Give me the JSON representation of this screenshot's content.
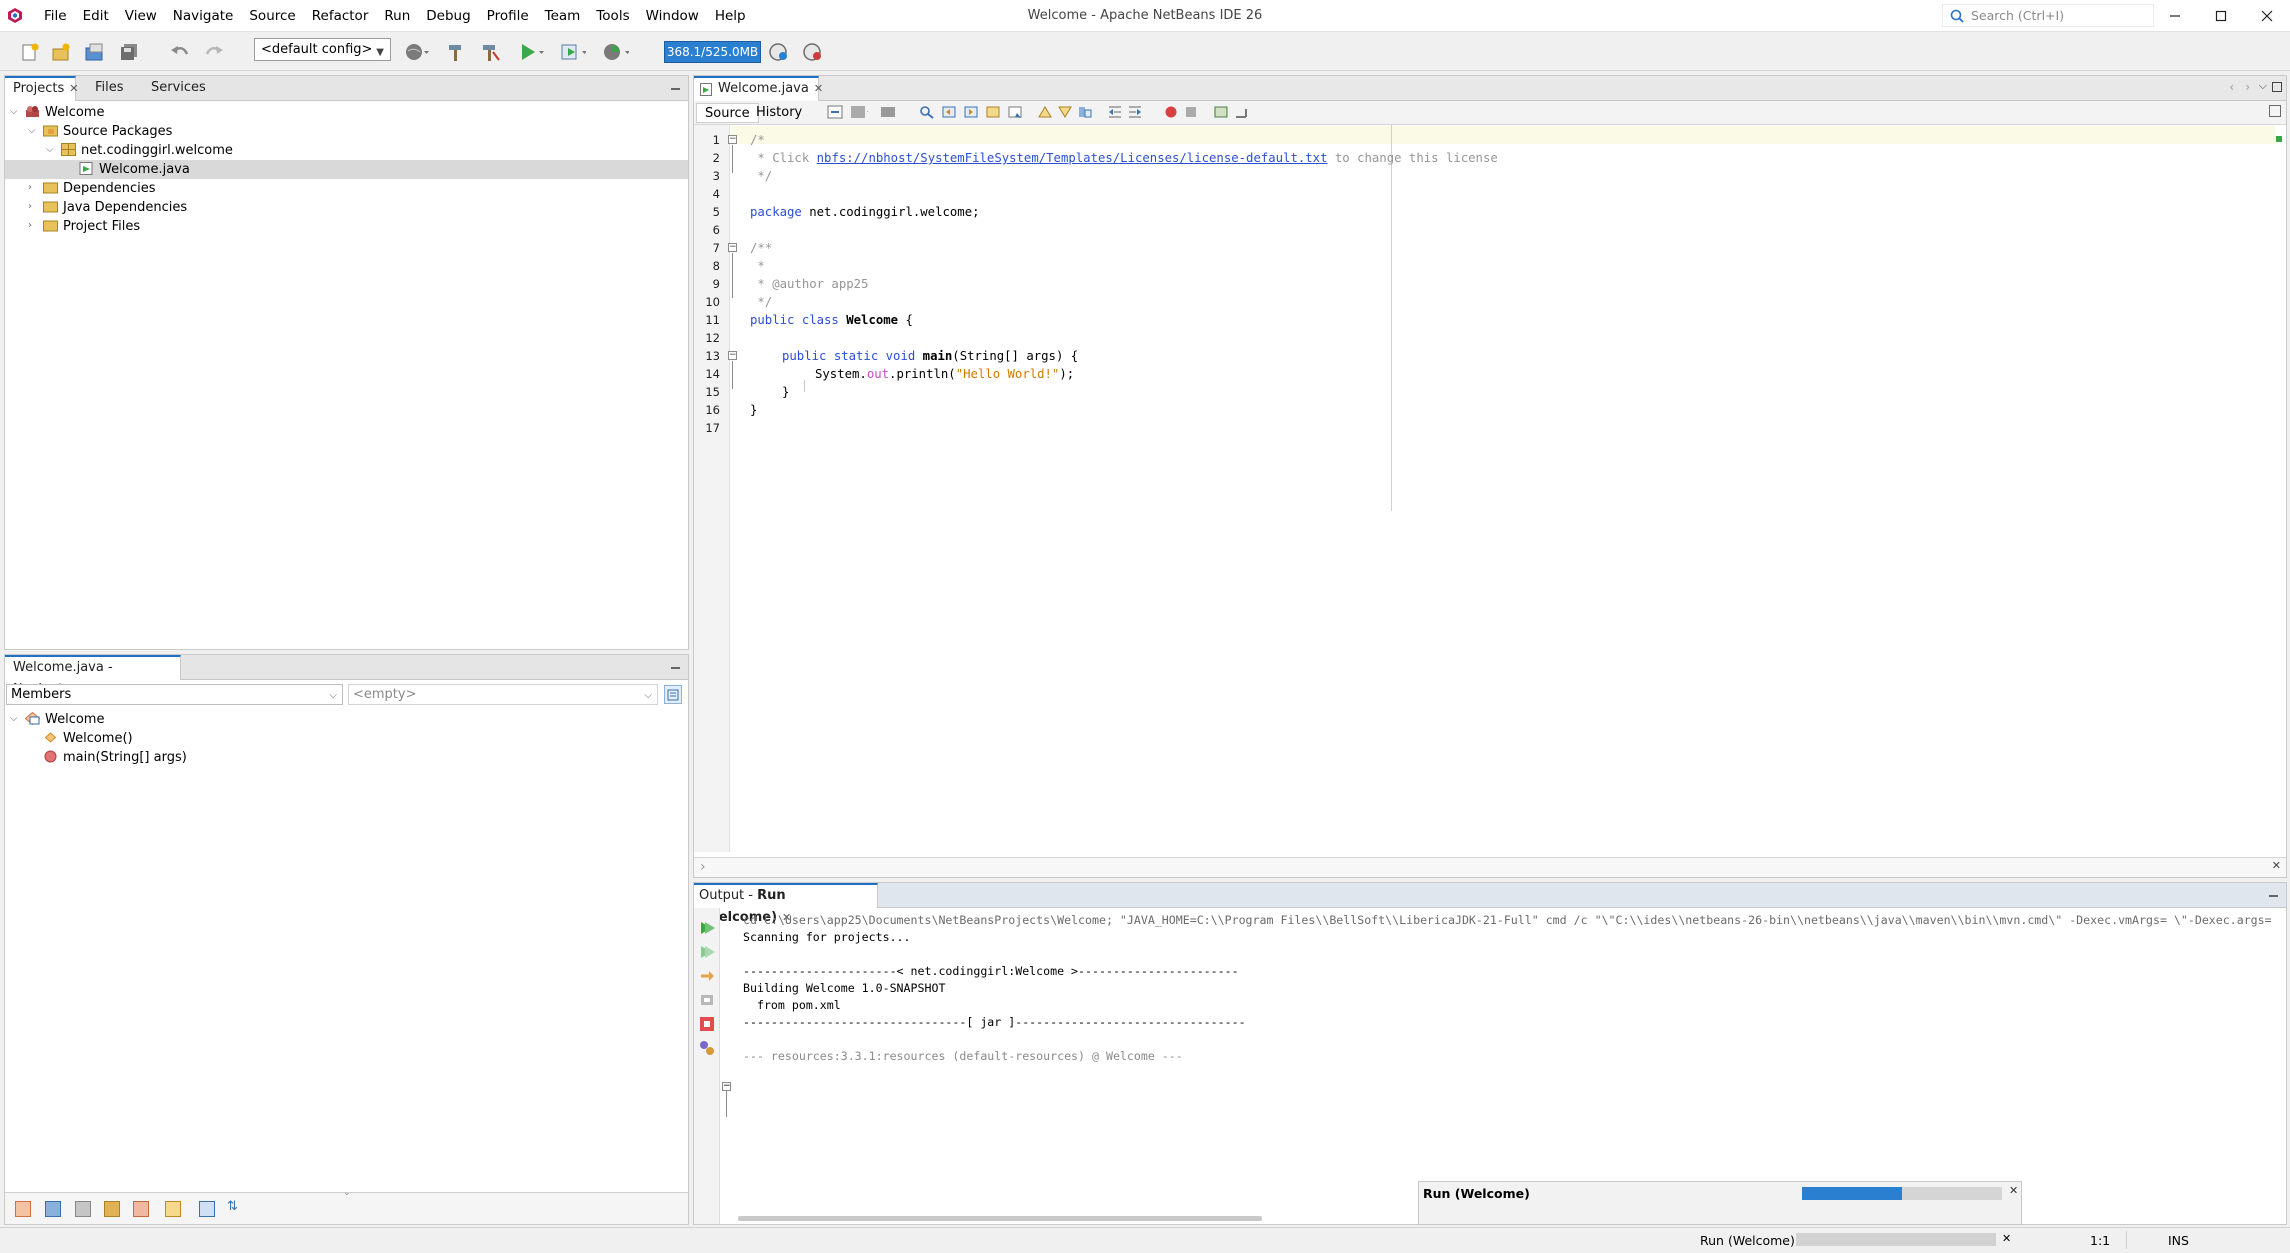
{
  "window": {
    "title": "Welcome - Apache NetBeans IDE 26",
    "menu": [
      "File",
      "Edit",
      "View",
      "Navigate",
      "Source",
      "Refactor",
      "Run",
      "Debug",
      "Profile",
      "Team",
      "Tools",
      "Window",
      "Help"
    ],
    "search_placeholder": "Search (Ctrl+I)"
  },
  "toolbar": {
    "config": "<default config>",
    "memory": "368.1/525.0MB"
  },
  "projects_panel": {
    "tabs": [
      "Projects",
      "Files",
      "Services"
    ],
    "tree": [
      "Welcome",
      "Source Packages",
      "net.codinggirl.welcome",
      "Welcome.java",
      "Dependencies",
      "Java Dependencies",
      "Project Files"
    ]
  },
  "navigator": {
    "tab": "Welcome.java - Navigator",
    "filter": "Members",
    "empty": "<empty>",
    "tree": {
      "root": "Welcome",
      "ctor": "Welcome()",
      "method_name": "main",
      "method_params": "(String[] args)"
    }
  },
  "editor": {
    "tab": "Welcome.java",
    "source_tab": "Source",
    "history_tab": "History",
    "line_numbers": [
      "1",
      "2",
      "3",
      "4",
      "5",
      "6",
      "7",
      "8",
      "9",
      "10",
      "11",
      "12",
      "13",
      "14",
      "15",
      "16",
      "17"
    ],
    "code": {
      "l1": "/*",
      "l2a": " * Click ",
      "l2link": "nbfs://nbhost/SystemFileSystem/Templates/Licenses/license-default.txt",
      "l2b": " to change this license",
      "l3": " */",
      "l5kw": "package",
      "l5": " net.codinggirl.welcome;",
      "l7": "/**",
      "l8": " *",
      "l9": " * @author app25",
      "l10": " */",
      "l11kw": "public class",
      "l11name": "Welcome",
      "l11end": " {",
      "l13kw": "public static void",
      "l13name": "main",
      "l13end": "(String[] args) {",
      "l14a": "System.",
      "l14b": "out",
      "l14c": ".println(",
      "l14str": "\"Hello World!\"",
      "l14d": ");",
      "l15": "}",
      "l16": "}"
    }
  },
  "output": {
    "tab_prefix": "Output - ",
    "tab_name": "Run (Welcome)",
    "lines": [
      "cd C:\\Users\\app25\\Documents\\NetBeansProjects\\Welcome; \"JAVA_HOME=C:\\\\Program Files\\\\BellSoft\\\\LibericaJDK-21-Full\" cmd /c \"\\\"C:\\\\ides\\\\netbeans-26-bin\\\\netbeans\\\\java\\\\maven\\\\bin\\\\mvn.cmd\\\" -Dexec.vmArgs= \\\"-Dexec.args=",
      "Scanning for projects...",
      "",
      "----------------------< net.codinggirl:Welcome >-----------------------",
      "Building Welcome 1.0-SNAPSHOT",
      "  from pom.xml",
      "--------------------------------[ jar ]---------------------------------",
      "",
      "--- resources:3.3.1:resources (default-resources) @ Welcome ---"
    ]
  },
  "progress_popup": {
    "title": "Run (Welcome)",
    "progress": 0.5
  },
  "status": {
    "task": "Run (Welcome)",
    "position": "1:1",
    "mode": "INS"
  }
}
